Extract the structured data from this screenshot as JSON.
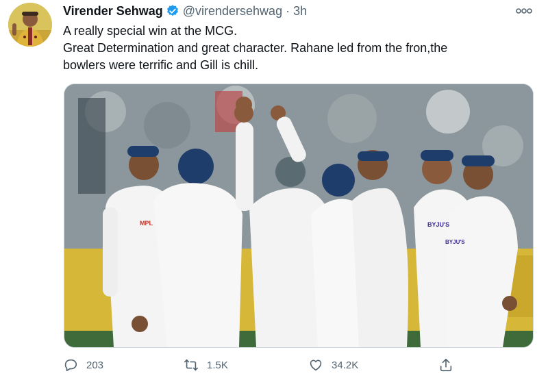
{
  "author": {
    "name": "Virender Sehwag",
    "handle": "@virendersehwag",
    "separator": "·",
    "time": "3h"
  },
  "tweet": {
    "lines": [
      "A really special win at the MCG.",
      "Great Determination and great character. Rahane led from the fron,the",
      "bowlers were terrific and Gill is chill."
    ]
  },
  "media": {
    "jersey_texts": [
      "MPL",
      "BYJU'S",
      "BYJU'S"
    ]
  },
  "actions": {
    "replies": "203",
    "retweets": "1.5K",
    "likes": "34.2K"
  },
  "colors": {
    "verified": "#1d9bf0",
    "secondary_text": "#536471",
    "primary_text": "#0f1419"
  },
  "icons": {
    "reply": "reply-icon",
    "retweet": "retweet-icon",
    "like": "heart-icon",
    "share": "share-icon",
    "more": "more-options-icon",
    "verified": "verified-badge-icon"
  }
}
